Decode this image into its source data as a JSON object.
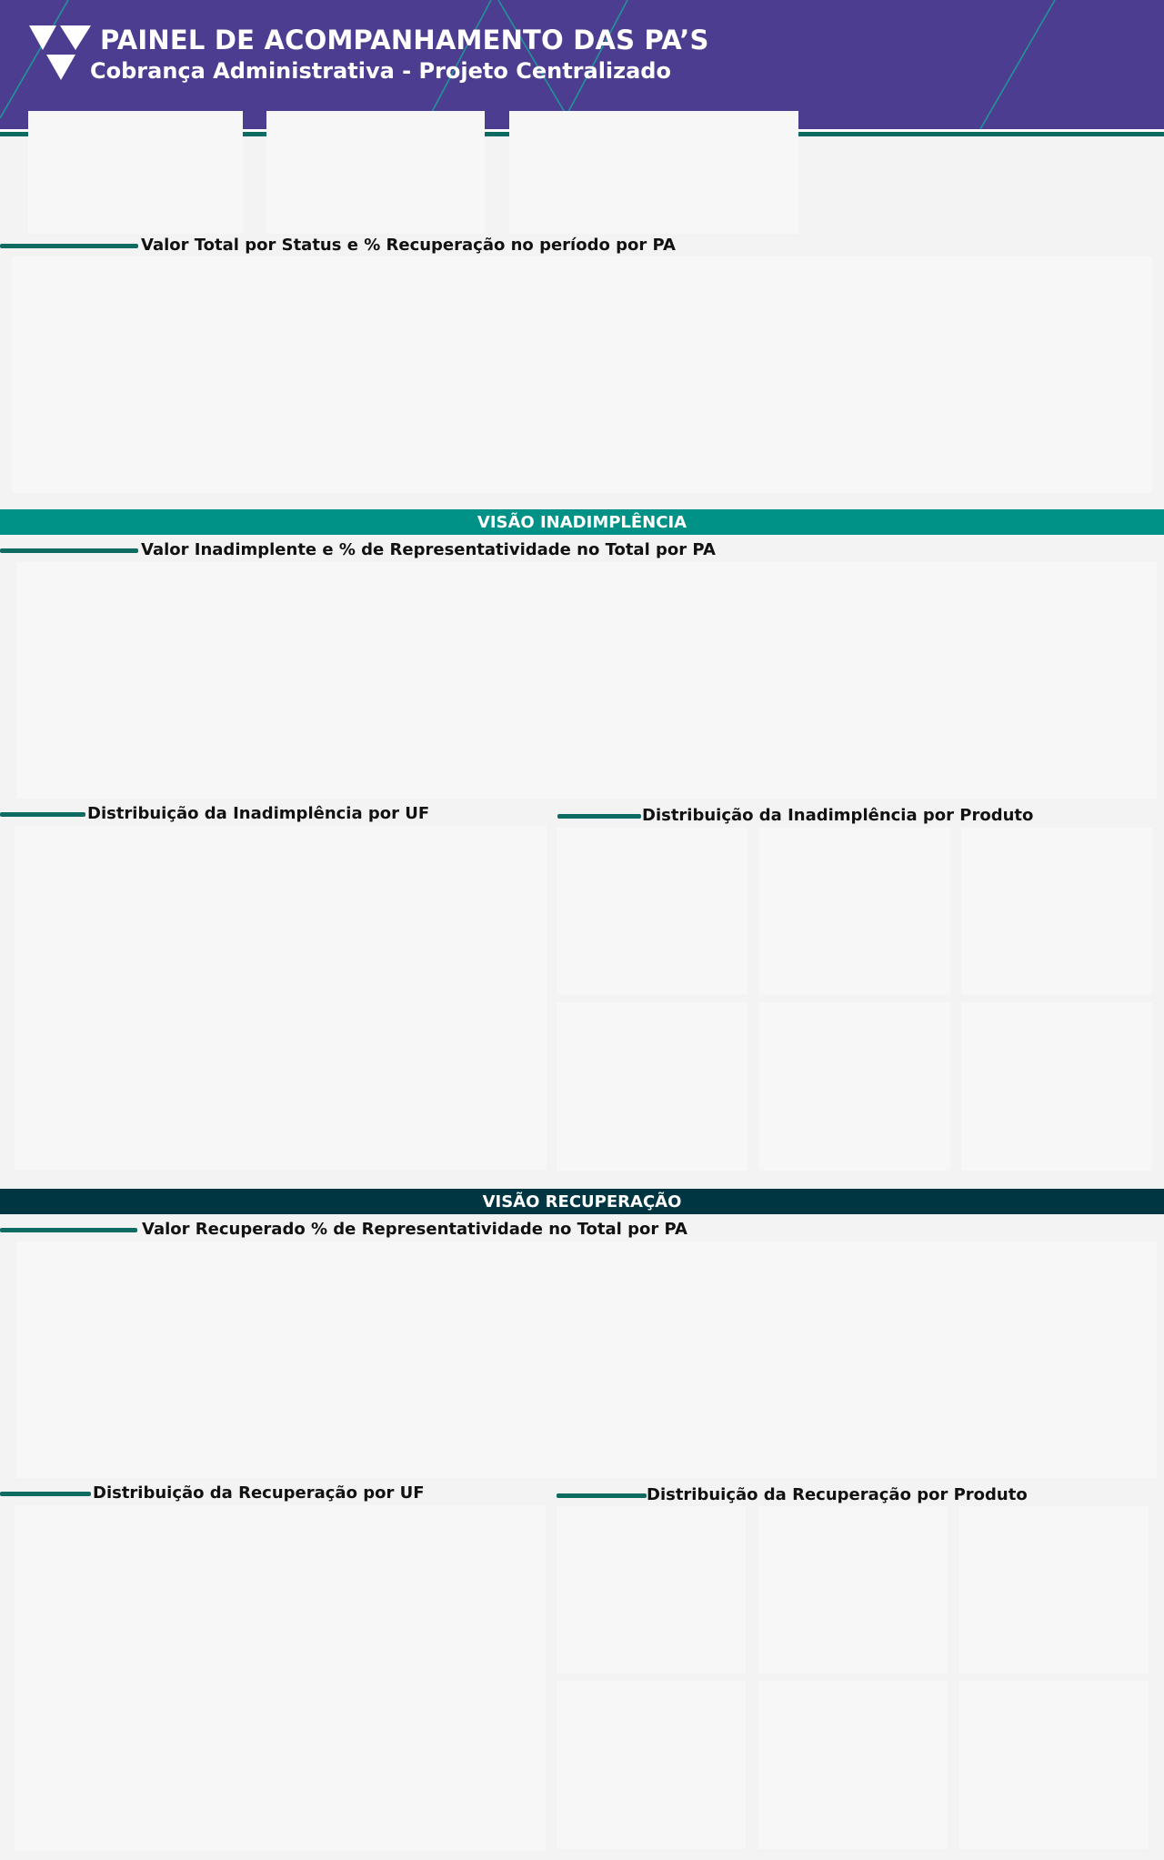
{
  "header": {
    "title": "PAINEL DE ACOMPANHAMENTO DAS PA’S",
    "subtitle": "Cobrança Administrativa - Projeto Centralizado",
    "logo_icon": "chevron-logo-icon"
  },
  "sections": {
    "status_chart_title": "Valor Total por Status e % Recuperação no período por PA",
    "inadimplencia_band": "VISÃO INADIMPLÊNCIA",
    "inadimplente_chart_title": "Valor Inadimplente e % de Representatividade no Total por PA",
    "inad_uf_title": "Distribuição da Inadimplência por UF",
    "inad_produto_title": "Distribuição da Inadimplência por Produto",
    "recuperacao_band": "VISÃO RECUPERAÇÃO",
    "recuperado_chart_title": "Valor Recuperado % de Representatividade no Total por PA",
    "rec_uf_title": "Distribuição da Recuperação por UF",
    "rec_produto_title": "Distribuição da Recuperação por Produto"
  },
  "colors": {
    "header_bg": "#4c3d91",
    "accent_teal": "#0e6b62",
    "band_inadimplencia": "#009286",
    "band_recuperacao": "#003641",
    "card_bg": "#f7f7f7",
    "page_bg": "#f3f3f3"
  }
}
